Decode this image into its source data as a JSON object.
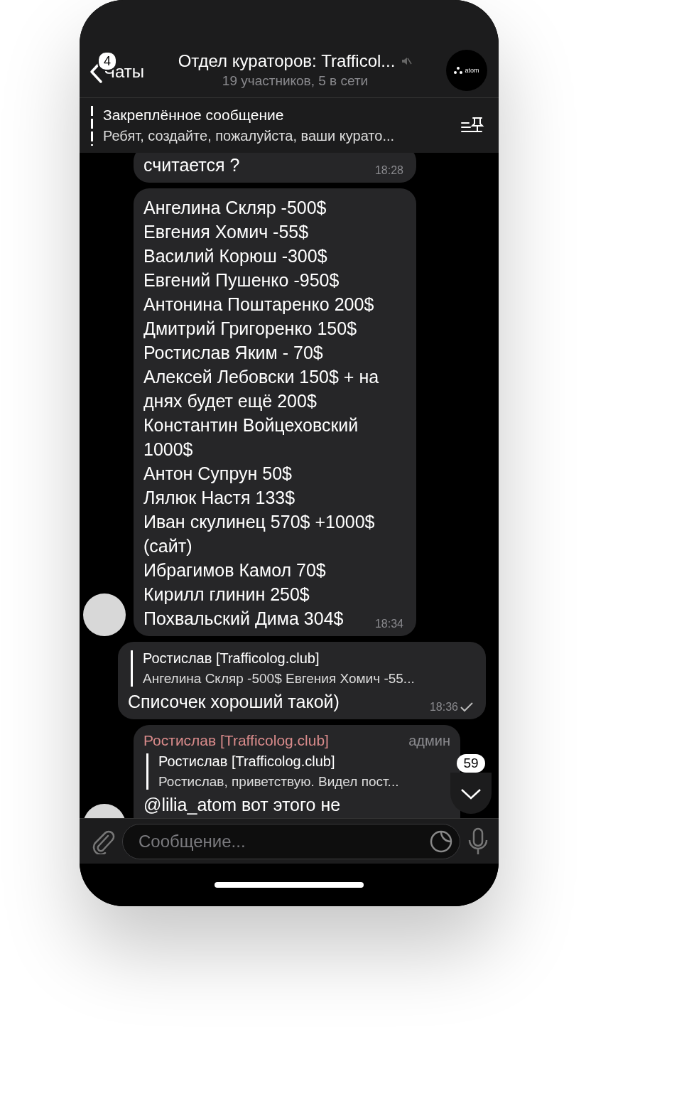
{
  "header": {
    "back_label": "Чаты",
    "unread_badge": "4",
    "title": "Отдел кураторов: Trafficol...",
    "muted": true,
    "subtitle": "19 участников, 5 в сети",
    "avatar_logo": "atom"
  },
  "pinned": {
    "title": "Закреплённое сообщение",
    "text": "Ребят, создайте, пожалуйста, ваши курато..."
  },
  "messages": [
    {
      "kind": "incoming",
      "text": "считается ?",
      "time": "18:28",
      "avatar": false
    },
    {
      "kind": "incoming",
      "lines": [
        "Ангелина Скляр -500$",
        "Евгения Хомич -55$",
        "Василий Корюш -300$",
        "Евгений Пушенко -950$",
        "Антонина Поштаренко 200$",
        "Дмитрий Григоренко 150$",
        "Ростислав Яким - 70$",
        "Алексей Лебовски 150$ + на днях будет ещё 200$",
        "Константин Войцеховский 1000$",
        "Антон Супрун 50$",
        "Лялюк Настя 133$",
        "Иван скулинец 570$ +1000$ (сайт)",
        "Ибрагимов Камол 70$",
        "Кирилл глинин 250$",
        "Похвальский Дима 304$"
      ],
      "time": "18:34",
      "avatar": true
    },
    {
      "kind": "outgoing",
      "reply": {
        "author": "Ростислав [Trafficolog.club]",
        "text": "Ангелина Скляр -500$ Евгения Хомич -55..."
      },
      "text": "Списочек хороший такой)",
      "time": "18:36",
      "read": false
    },
    {
      "kind": "incoming",
      "sender": "Ростислав [Trafficolog.club]",
      "role": "админ",
      "reply": {
        "author": "Ростислав [Trafficolog.club]",
        "text": "Ростислав, приветствую. Видел пост..."
      },
      "text": "@lilia_atom  вот этого не",
      "avatar": true
    }
  ],
  "scroll_down": {
    "count": "59"
  },
  "input": {
    "placeholder": "Сообщение..."
  }
}
